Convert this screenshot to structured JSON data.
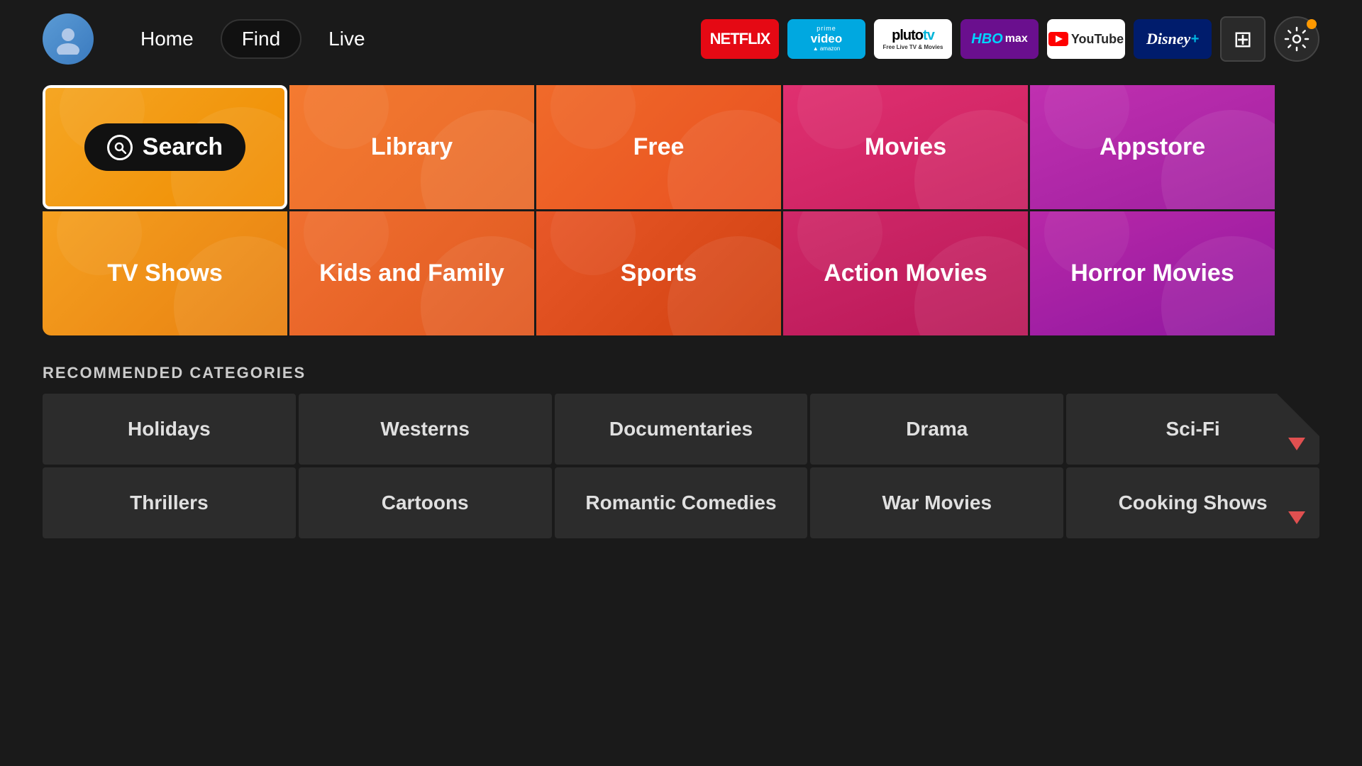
{
  "nav": {
    "home_label": "Home",
    "find_label": "Find",
    "live_label": "Live"
  },
  "services": [
    {
      "id": "netflix",
      "label": "NETFLIX",
      "class": "netflix"
    },
    {
      "id": "prime",
      "label": "prime video",
      "class": "prime"
    },
    {
      "id": "pluto",
      "label": "pluto tv",
      "class": "pluto"
    },
    {
      "id": "hbomax",
      "label": "HBO max",
      "class": "hbomax"
    },
    {
      "id": "youtube",
      "label": "YouTube",
      "class": "youtube"
    },
    {
      "id": "disney",
      "label": "Disney+",
      "class": "disney"
    }
  ],
  "grid": {
    "search_label": "Search",
    "library_label": "Library",
    "free_label": "Free",
    "movies_label": "Movies",
    "appstore_label": "Appstore",
    "tvshows_label": "TV Shows",
    "kidsandfamily_label": "Kids and Family",
    "sports_label": "Sports",
    "actionmovies_label": "Action Movies",
    "horrormovies_label": "Horror Movies"
  },
  "recommended": {
    "section_title": "RECOMMENDED CATEGORIES",
    "items": [
      "Holidays",
      "Westerns",
      "Documentaries",
      "Drama",
      "Sci-Fi",
      "Thrillers",
      "Cartoons",
      "Romantic Comedies",
      "War Movies",
      "Cooking Shows"
    ]
  }
}
